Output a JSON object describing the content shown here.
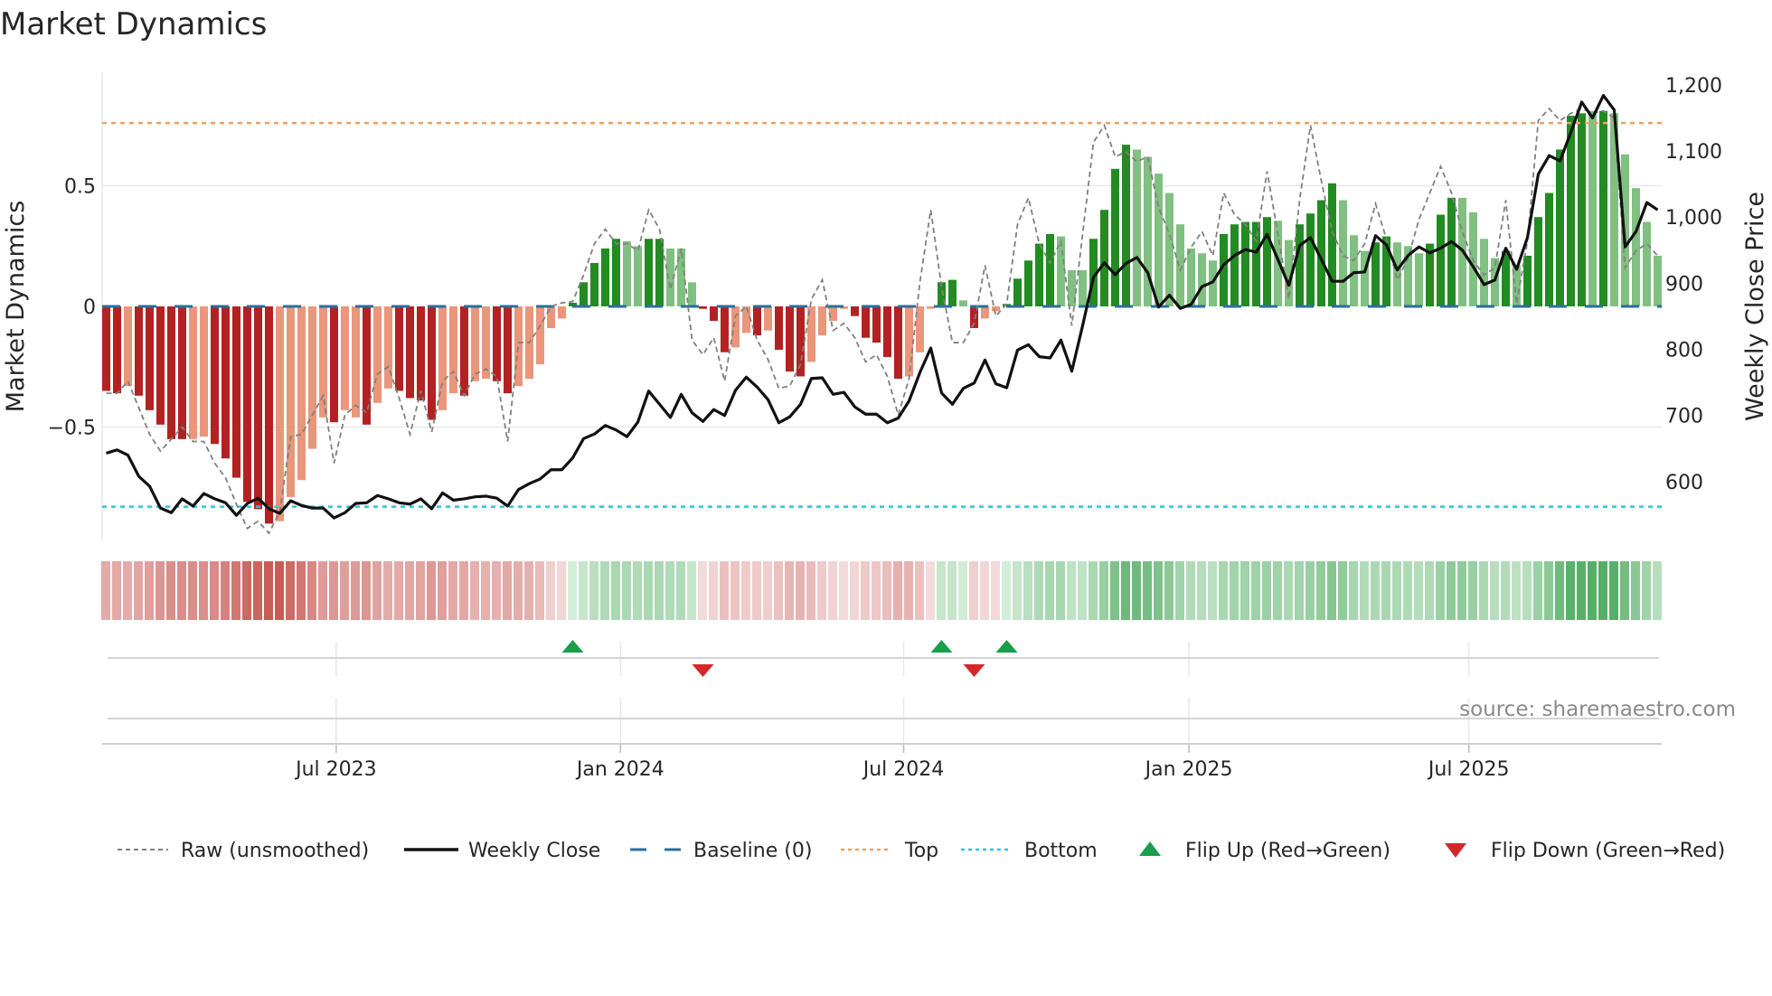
{
  "chart_data": {
    "type": "bar",
    "title": "Market Dynamics",
    "ylabel": "Market Dynamics",
    "ylabel_right": "Weekly Close Price",
    "ylim": [
      -0.97,
      0.97
    ],
    "ylim_right": [
      511,
      1219
    ],
    "yticks": [
      {
        "v": 0.5,
        "label": "0.5"
      },
      {
        "v": 0,
        "label": "0"
      },
      {
        "v": -0.5,
        "label": "−0.5"
      }
    ],
    "yticks_right": [
      {
        "v": 1200,
        "label": "1,200"
      },
      {
        "v": 1100,
        "label": "1,100"
      },
      {
        "v": 1000,
        "label": "1,000"
      },
      {
        "v": 900,
        "label": "900"
      },
      {
        "v": 800,
        "label": "800"
      },
      {
        "v": 700,
        "label": "700"
      },
      {
        "v": 600,
        "label": "600"
      }
    ],
    "x_unit": "week index",
    "xticks": [
      {
        "week": 21.2,
        "label": "Jul 2023"
      },
      {
        "week": 47.4,
        "label": "Jan 2024"
      },
      {
        "week": 73.5,
        "label": "Jul 2024"
      },
      {
        "week": 99.8,
        "label": "Jan 2025"
      },
      {
        "week": 125.6,
        "label": "Jul 2025"
      }
    ],
    "top_level": 0.76,
    "bottom_level": -0.83,
    "baseline": 0,
    "values": [
      -0.35,
      -0.36,
      -0.33,
      -0.37,
      -0.43,
      -0.49,
      -0.55,
      -0.55,
      -0.55,
      -0.54,
      -0.57,
      -0.63,
      -0.71,
      -0.81,
      -0.84,
      -0.9,
      -0.89,
      -0.79,
      -0.72,
      -0.59,
      -0.46,
      -0.48,
      -0.43,
      -0.46,
      -0.49,
      -0.4,
      -0.34,
      -0.35,
      -0.38,
      -0.39,
      -0.47,
      -0.43,
      -0.36,
      -0.37,
      -0.31,
      -0.3,
      -0.31,
      -0.36,
      -0.33,
      -0.3,
      -0.24,
      -0.09,
      -0.05,
      0.015,
      0.1,
      0.18,
      0.24,
      0.28,
      0.27,
      0.25,
      0.28,
      0.28,
      0.24,
      0.24,
      0.1,
      -0.01,
      -0.06,
      -0.19,
      -0.17,
      -0.11,
      -0.12,
      -0.1,
      -0.18,
      -0.27,
      -0.29,
      -0.23,
      -0.12,
      -0.06,
      -0.01,
      -0.04,
      -0.13,
      -0.15,
      -0.21,
      -0.3,
      -0.29,
      -0.19,
      -0.01,
      0.1,
      0.11,
      0.025,
      -0.09,
      -0.05,
      -0.02,
      0.01,
      0.115,
      0.19,
      0.26,
      0.3,
      0.29,
      0.15,
      0.15,
      0.28,
      0.4,
      0.57,
      0.67,
      0.65,
      0.62,
      0.55,
      0.47,
      0.34,
      0.24,
      0.22,
      0.19,
      0.3,
      0.34,
      0.35,
      0.35,
      0.37,
      0.355,
      0.275,
      0.34,
      0.385,
      0.44,
      0.51,
      0.44,
      0.295,
      0.23,
      0.265,
      0.29,
      0.265,
      0.25,
      0.22,
      0.26,
      0.38,
      0.45,
      0.45,
      0.39,
      0.28,
      0.2,
      0.23,
      0.17,
      0.21,
      0.37,
      0.47,
      0.65,
      0.79,
      0.8,
      0.81,
      0.81,
      0.8,
      0.63,
      0.49,
      0.35,
      0.21
    ],
    "tone": "DDLDDDDDLLDDDDDDLLLLLDLLDLLDDDDLLDLLDDLLLLLDDDDDLLDDLLLDDDLLDLDDDLLLLDDDDDLLLDDLDLLDDDDDLLLDDDDLLLLLLLLDDDDDLLDDDDLLLDDLLLDDDLLLLDLDDDDDDLDLLLLL",
    "raw": [
      -0.36,
      -0.36,
      -0.31,
      -0.42,
      -0.53,
      -0.6,
      -0.55,
      -0.5,
      -0.56,
      -0.56,
      -0.65,
      -0.71,
      -0.82,
      -0.92,
      -0.89,
      -0.94,
      -0.85,
      -0.54,
      -0.53,
      -0.45,
      -0.37,
      -0.65,
      -0.45,
      -0.41,
      -0.44,
      -0.28,
      -0.25,
      -0.38,
      -0.53,
      -0.35,
      -0.52,
      -0.31,
      -0.27,
      -0.37,
      -0.28,
      -0.26,
      -0.29,
      -0.56,
      -0.15,
      -0.15,
      -0.08,
      0,
      0.015,
      0.02,
      0.13,
      0.26,
      0.32,
      0.26,
      0.26,
      0.23,
      0.4,
      0.32,
      0.07,
      0.24,
      -0.14,
      -0.2,
      -0.13,
      -0.31,
      -0.04,
      0.0,
      -0.14,
      -0.22,
      -0.34,
      -0.33,
      -0.24,
      0.03,
      0.11,
      -0.1,
      -0.07,
      -0.13,
      -0.23,
      -0.2,
      -0.29,
      -0.45,
      -0.3,
      0.1,
      0.4,
      0.08,
      -0.15,
      -0.15,
      -0.07,
      0.17,
      -0.04,
      0.01,
      0.34,
      0.45,
      0.26,
      0.18,
      0.27,
      -0.08,
      0.3,
      0.68,
      0.75,
      0.62,
      0.64,
      0.6,
      0.62,
      0.41,
      0.3,
      0.15,
      0.245,
      0.31,
      0.21,
      0.47,
      0.38,
      0.34,
      0.27,
      0.56,
      0.3,
      0.03,
      0.44,
      0.75,
      0.52,
      0.31,
      0.21,
      0.19,
      0.26,
      0.425,
      0.28,
      0.11,
      0.2,
      0.36,
      0.47,
      0.58,
      0.47,
      0.31,
      0.19,
      0.13,
      0.16,
      0.44,
      0.01,
      0.27,
      0.77,
      0.82,
      0.77,
      0.8,
      0.82,
      0.8,
      0.81,
      0.78,
      0.16,
      0.23,
      0.26,
      0.21
    ],
    "price": [
      643,
      648,
      640,
      608,
      593,
      560,
      553,
      574,
      563,
      582,
      574,
      568,
      549,
      567,
      575,
      559,
      552,
      571,
      564,
      560,
      560,
      545,
      553,
      567,
      568,
      579,
      574,
      568,
      566,
      574,
      559,
      583,
      572,
      574,
      577,
      578,
      575,
      563,
      588,
      597,
      604,
      618,
      618,
      636,
      665,
      672,
      685,
      678,
      668,
      690,
      737,
      717,
      697,
      732,
      704,
      691,
      709,
      700,
      738,
      758,
      743,
      724,
      689,
      698,
      717,
      756,
      757,
      732,
      735,
      713,
      702,
      702,
      689,
      696,
      722,
      765,
      802,
      734,
      717,
      741,
      749,
      784,
      748,
      742,
      799,
      807,
      789,
      787,
      814,
      767,
      836,
      909,
      931,
      913,
      930,
      939,
      916,
      864,
      882,
      862,
      868,
      895,
      902,
      928,
      942,
      951,
      947,
      974,
      936,
      897,
      957,
      969,
      936,
      903,
      903,
      916,
      917,
      972,
      958,
      920,
      942,
      955,
      946,
      953,
      963,
      950,
      925,
      898,
      905,
      953,
      921,
      969,
      1065,
      1093,
      1085,
      1128,
      1174,
      1150,
      1184,
      1162,
      955,
      978,
      1022,
      1011
    ],
    "flips": [
      {
        "week": 43,
        "dir": "up"
      },
      {
        "week": 55,
        "dir": "down"
      },
      {
        "week": 77,
        "dir": "up"
      },
      {
        "week": 80,
        "dir": "down"
      },
      {
        "week": 83,
        "dir": "up"
      }
    ],
    "legend": {
      "placement": "bottom",
      "items": [
        {
          "key": "raw",
          "label": "Raw (unsmoothed)"
        },
        {
          "key": "close",
          "label": "Weekly Close"
        },
        {
          "key": "baseline",
          "label": "Baseline (0)"
        },
        {
          "key": "top",
          "label": "Top"
        },
        {
          "key": "bottom",
          "label": "Bottom"
        },
        {
          "key": "flipup",
          "label": "Flip Up (Red→Green)"
        },
        {
          "key": "flipdown",
          "label": "Flip Down (Green→Red)"
        }
      ]
    },
    "source": "source: sharemaestro.com"
  },
  "colors": {
    "neg_strong": "#b22222",
    "neg_weak": "#e9967a",
    "pos_strong": "#228b22",
    "pos_weak": "#80c080",
    "raw": "#808080",
    "close": "#111111",
    "baseline": "#2a6f9e",
    "top": "#f0a060",
    "bottom": "#2cc4dc",
    "flip_up": "#1a9e4a",
    "flip_down": "#d62728"
  }
}
